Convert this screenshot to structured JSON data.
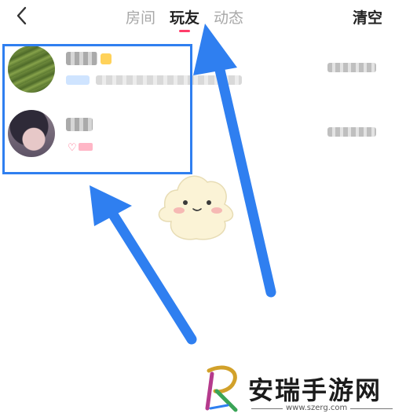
{
  "header": {
    "back_icon": "chevron-left-icon",
    "tabs": [
      {
        "label": "房间",
        "active": false
      },
      {
        "label": "玩友",
        "active": true
      },
      {
        "label": "动态",
        "active": false
      }
    ],
    "clear_label": "清空"
  },
  "friends": {
    "rows": [
      {
        "avatar": "avatar-green-field",
        "badge_icon": "crown-icon"
      },
      {
        "avatar": "avatar-portrait",
        "badge_icon": "heart-icon",
        "heart_glyph": "♡"
      }
    ]
  },
  "annotation": {
    "highlight_color": "#2f7ff0",
    "arrow_color": "#2f7ff0"
  },
  "watermark": {
    "name": "安瑞手游网",
    "url": "www.szerg.com"
  },
  "colors": {
    "tab_active": "#222222",
    "tab_inactive": "#a8a8a8",
    "tab_indicator": "#ff3d6a"
  }
}
